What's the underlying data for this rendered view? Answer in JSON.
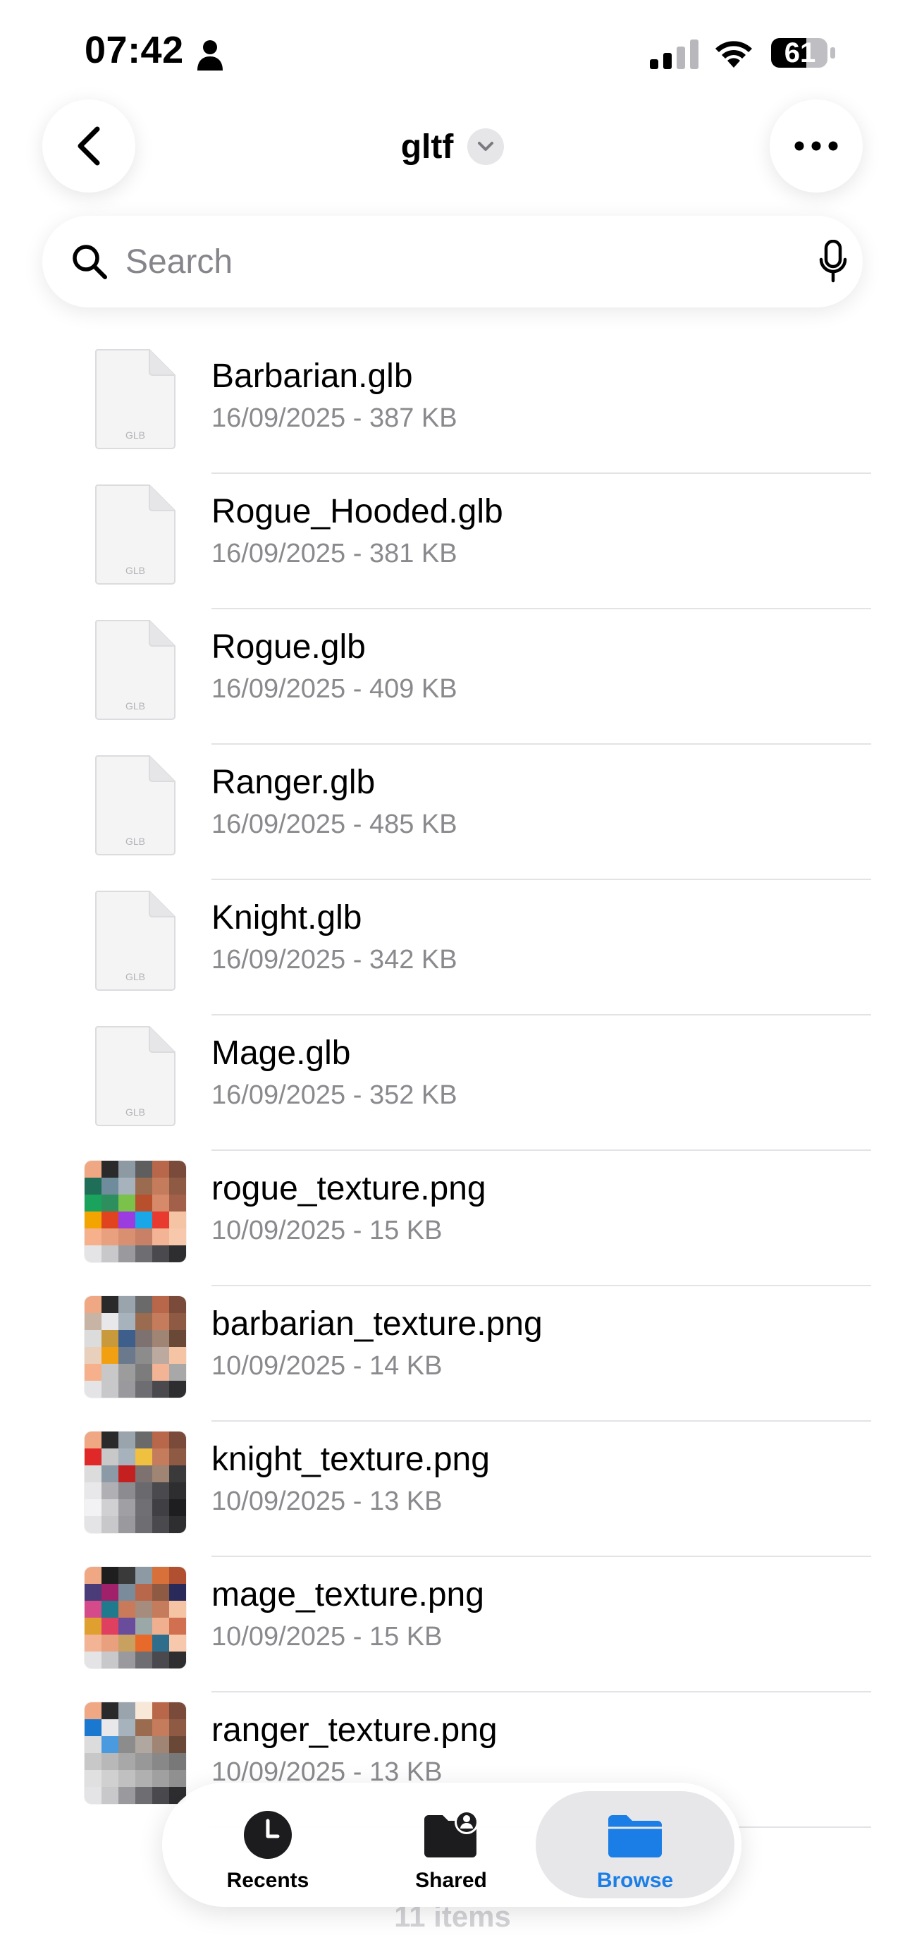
{
  "status_bar": {
    "time": "07:42",
    "battery": "61"
  },
  "header": {
    "title": "gltf"
  },
  "search": {
    "placeholder": "Search",
    "value": ""
  },
  "files": [
    {
      "name": "Barbarian.glb",
      "meta": "16/09/2025 - 387 KB",
      "type_label": "GLB"
    },
    {
      "name": "Rogue_Hooded.glb",
      "meta": "16/09/2025 - 381 KB",
      "type_label": "GLB"
    },
    {
      "name": "Rogue.glb",
      "meta": "16/09/2025 - 409 KB",
      "type_label": "GLB"
    },
    {
      "name": "Ranger.glb",
      "meta": "16/09/2025 - 485 KB",
      "type_label": "GLB"
    },
    {
      "name": "Knight.glb",
      "meta": "16/09/2025 - 342 KB",
      "type_label": "GLB"
    },
    {
      "name": "Mage.glb",
      "meta": "16/09/2025 - 352 KB",
      "type_label": "GLB"
    },
    {
      "name": "rogue_texture.png",
      "meta": "10/09/2025 - 15 KB",
      "palette": [
        "#f0a884",
        "#2a2a2a",
        "#8d9aa4",
        "#5e5e5e",
        "#b8674a",
        "#7a4b3a",
        "#1f6e58",
        "#6e8c9c",
        "#a6b2bc",
        "#9a6b4f",
        "#c47c5c",
        "#8f5a44",
        "#19a35c",
        "#2e8f5e",
        "#7ac24a",
        "#b8502e",
        "#d78a6a",
        "#a2604a",
        "#f2a500",
        "#e0441e",
        "#9a3ce0",
        "#1aa7e8",
        "#e83a2e",
        "#f5c4a4",
        "#f7b08c",
        "#e8a07e",
        "#d89070",
        "#c88066",
        "#f2b494",
        "#f8c8ac"
      ]
    },
    {
      "name": "barbarian_texture.png",
      "meta": "10/09/2025 - 14 KB",
      "palette": [
        "#f0a884",
        "#2a2a2a",
        "#9aa4ac",
        "#6a6a6a",
        "#b8674a",
        "#7a4b3a",
        "#c8b4a4",
        "#e8e8ea",
        "#a6b2bc",
        "#9a6b4f",
        "#c47c5c",
        "#8f5a44",
        "#dcdcdc",
        "#c89a3c",
        "#3e5e8c",
        "#7e7270",
        "#a08474",
        "#6a4838",
        "#e8d0bc",
        "#f0a010",
        "#6a7a8c",
        "#8c8c8c",
        "#bcaaa0",
        "#f5c4a4",
        "#f7b08c",
        "#c8c8c8",
        "#9c9c9c",
        "#7c7c7c",
        "#f2b494",
        "#a8a8a8"
      ]
    },
    {
      "name": "knight_texture.png",
      "meta": "10/09/2025 - 13 KB",
      "palette": [
        "#f0a884",
        "#2a2a2a",
        "#9aa4ac",
        "#6a6a6a",
        "#b8674a",
        "#7a4b3a",
        "#e02828",
        "#c8c8c8",
        "#a6b2bc",
        "#f0c040",
        "#c47c5c",
        "#8f5a44",
        "#dcdcdc",
        "#8c9aa8",
        "#c42020",
        "#7e7270",
        "#a08474",
        "#3a3a3a",
        "#e8e8ea",
        "#b0b0b4",
        "#8c8c90",
        "#6a6a6e",
        "#4a4a4e",
        "#2e2e30",
        "#f2f2f4",
        "#d0d0d2",
        "#a0a0a4",
        "#707074",
        "#404044",
        "#1e1e20"
      ]
    },
    {
      "name": "mage_texture.png",
      "meta": "10/09/2025 - 15 KB",
      "palette": [
        "#f0a884",
        "#1e1e1e",
        "#3a3a3a",
        "#8d9aa4",
        "#d8703a",
        "#b05030",
        "#4a3c78",
        "#a0206a",
        "#7a8c9c",
        "#b8674a",
        "#8f5a44",
        "#2a2a5a",
        "#d44a8a",
        "#1e7a8c",
        "#c87a5a",
        "#a68c7c",
        "#c47c5c",
        "#f5c4a4",
        "#e0a030",
        "#e04060",
        "#6a4c9c",
        "#9aa8a8",
        "#f0b090",
        "#d07050",
        "#f2b494",
        "#e8a07e",
        "#c8a060",
        "#e86a2a",
        "#2e6e8c",
        "#f8c8ac"
      ]
    },
    {
      "name": "ranger_texture.png",
      "meta": "10/09/2025 - 13 KB",
      "palette": [
        "#f0a884",
        "#2a2a2a",
        "#9aa4ac",
        "#f8e8d8",
        "#b8674a",
        "#7a4b3a",
        "#1a78d0",
        "#e8e8ea",
        "#a6b2bc",
        "#9a6b4f",
        "#c47c5c",
        "#8f5a44",
        "#dcdcdc",
        "#4a9ae0",
        "#8c8c8c",
        "#b0a8a0",
        "#a08474",
        "#6a4838",
        "#c8c8c8",
        "#b8b8b8",
        "#a8a8a8",
        "#989898",
        "#888888",
        "#787878",
        "#e0e0e0",
        "#d0d0d0",
        "#c0c0c0",
        "#b0b0b0",
        "#a0a0a0",
        "#909090"
      ]
    }
  ],
  "tab_bar": {
    "tabs": [
      {
        "label": "Recents"
      },
      {
        "label": "Shared"
      },
      {
        "label": "Browse"
      }
    ],
    "active": "Browse"
  },
  "footer": {
    "items_count": "11 items"
  },
  "colors": {
    "accent": "#1a7ee6",
    "meta_text": "#8a8a8e",
    "divider": "#e3e3e6"
  }
}
